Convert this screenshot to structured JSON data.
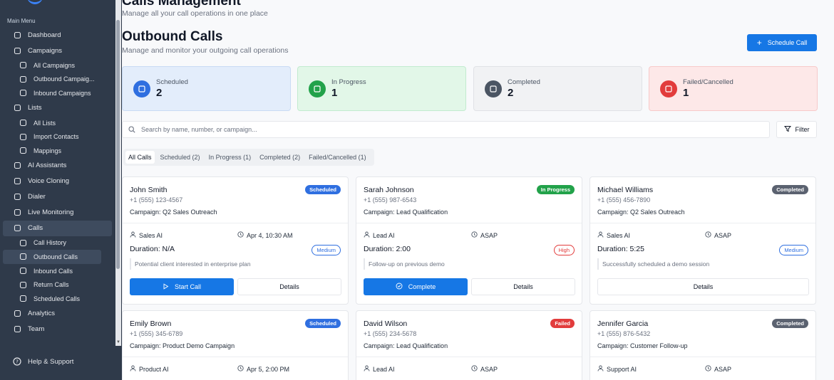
{
  "sidebar": {
    "menu_heading": "Main Menu",
    "items": [
      {
        "label": "Dashboard",
        "icon": "home-icon",
        "sub": false
      },
      {
        "label": "Campaigns",
        "icon": "campaigns-icon",
        "sub": false
      },
      {
        "label": "All Campaigns",
        "icon": "list-arrow-icon",
        "sub": true
      },
      {
        "label": "Outbound Campaig...",
        "icon": "phone-outgoing-icon",
        "sub": true
      },
      {
        "label": "Inbound Campaigns",
        "icon": "phone-incoming-icon",
        "sub": true
      },
      {
        "label": "Lists",
        "icon": "clipboard-icon",
        "sub": false
      },
      {
        "label": "All Lists",
        "icon": "clipboard-icon",
        "sub": true
      },
      {
        "label": "Import Contacts",
        "icon": "import-icon",
        "sub": true
      },
      {
        "label": "Mappings",
        "icon": "mapping-icon",
        "sub": true
      },
      {
        "label": "AI Assistants",
        "icon": "bot-icon",
        "sub": false
      },
      {
        "label": "Voice Cloning",
        "icon": "mic-icon",
        "sub": false
      },
      {
        "label": "Dialer",
        "icon": "phone-icon",
        "sub": false
      },
      {
        "label": "Live Monitoring",
        "icon": "headphones-icon",
        "sub": false
      },
      {
        "label": "Calls",
        "icon": "phone-call-icon",
        "sub": false,
        "active": true
      },
      {
        "label": "Call History",
        "icon": "history-icon",
        "sub": true
      },
      {
        "label": "Outbound Calls",
        "icon": "phone-outgoing-icon",
        "sub": true,
        "active": true
      },
      {
        "label": "Inbound Calls",
        "icon": "phone-incoming-icon",
        "sub": true
      },
      {
        "label": "Return Calls",
        "icon": "rotate-icon",
        "sub": true
      },
      {
        "label": "Scheduled Calls",
        "icon": "calendar-clock-icon",
        "sub": true
      },
      {
        "label": "Analytics",
        "icon": "chart-icon",
        "sub": false
      },
      {
        "label": "Team",
        "icon": "users-icon",
        "sub": false
      }
    ],
    "help_label": "Help & Support"
  },
  "header": {
    "top_title": "Calls Management",
    "top_subtitle": "Manage all your call operations in one place",
    "title": "Outbound Calls",
    "subtitle": "Manage and monitor your outgoing call operations",
    "schedule_button": "Schedule Call"
  },
  "stats": [
    {
      "label": "Scheduled",
      "value": "2",
      "icon": "calendar-icon",
      "bg": "#e3edfb",
      "border": "#c9dbf4",
      "icon_bg": "#2f6fe0"
    },
    {
      "label": "In Progress",
      "value": "1",
      "icon": "phone-icon",
      "bg": "#e2f7e8",
      "border": "#c2ebcf",
      "icon_bg": "#22a24a"
    },
    {
      "label": "Completed",
      "value": "2",
      "icon": "chart-icon",
      "bg": "#f1f2f4",
      "border": "#e0e2e6",
      "icon_bg": "#4b5563"
    },
    {
      "label": "Failed/Cancelled",
      "value": "1",
      "icon": "phone-off-icon",
      "bg": "#fde8e8",
      "border": "#f7caca",
      "icon_bg": "#e23c3c"
    }
  ],
  "search": {
    "placeholder": "Search by name, number, or campaign..."
  },
  "filter_label": "Filter",
  "tabs": [
    {
      "label": "All Calls",
      "active": true
    },
    {
      "label": "Scheduled (2)"
    },
    {
      "label": "In Progress (1)"
    },
    {
      "label": "Completed (2)"
    },
    {
      "label": "Failed/Cancelled (1)"
    }
  ],
  "calls": [
    {
      "name": "John Smith",
      "phone": "+1 (555) 123-4567",
      "campaign": "Campaign: Q2 Sales Outreach",
      "status": "Scheduled",
      "status_color": "#2f6fe0",
      "agent": "Sales AI",
      "time": "Apr 4, 10:30 AM",
      "duration": "Duration: N/A",
      "priority": "Medium",
      "priority_color": "#2f6fe0",
      "note": "Potential client interested in enterprise plan",
      "action": "Start Call",
      "action_icon": "play-icon",
      "details": "Details"
    },
    {
      "name": "Sarah Johnson",
      "phone": "+1 (555) 987-6543",
      "campaign": "Campaign: Lead Qualification",
      "status": "In Progress",
      "status_color": "#22a24a",
      "agent": "Lead AI",
      "time": "ASAP",
      "duration": "Duration: 2:00",
      "priority": "High",
      "priority_color": "#e23c3c",
      "note": "Follow-up on previous demo",
      "action": "Complete",
      "action_icon": "check-circle-icon",
      "details": "Details"
    },
    {
      "name": "Michael Williams",
      "phone": "+1 (555) 456-7890",
      "campaign": "Campaign: Q2 Sales Outreach",
      "status": "Completed",
      "status_color": "#5b6270",
      "agent": "Sales AI",
      "time": "ASAP",
      "duration": "Duration: 5:25",
      "priority": "Medium",
      "priority_color": "#2f6fe0",
      "note": "Successfully scheduled a demo session",
      "action": "",
      "details": "Details"
    },
    {
      "name": "Emily Brown",
      "phone": "+1 (555) 345-6789",
      "campaign": "Campaign: Product Demo Campaign",
      "status": "Scheduled",
      "status_color": "#2f6fe0",
      "agent": "Product AI",
      "time": "Apr 5, 2:00 PM"
    },
    {
      "name": "David Wilson",
      "phone": "+1 (555) 234-5678",
      "campaign": "Campaign: Lead Qualification",
      "status": "Failed",
      "status_color": "#e23c3c",
      "agent": "Lead AI",
      "time": "ASAP"
    },
    {
      "name": "Jennifer Garcia",
      "phone": "+1 (555) 876-5432",
      "campaign": "Campaign: Customer Follow-up",
      "status": "Completed",
      "status_color": "#5b6270",
      "agent": "Support AI",
      "time": "ASAP"
    }
  ]
}
